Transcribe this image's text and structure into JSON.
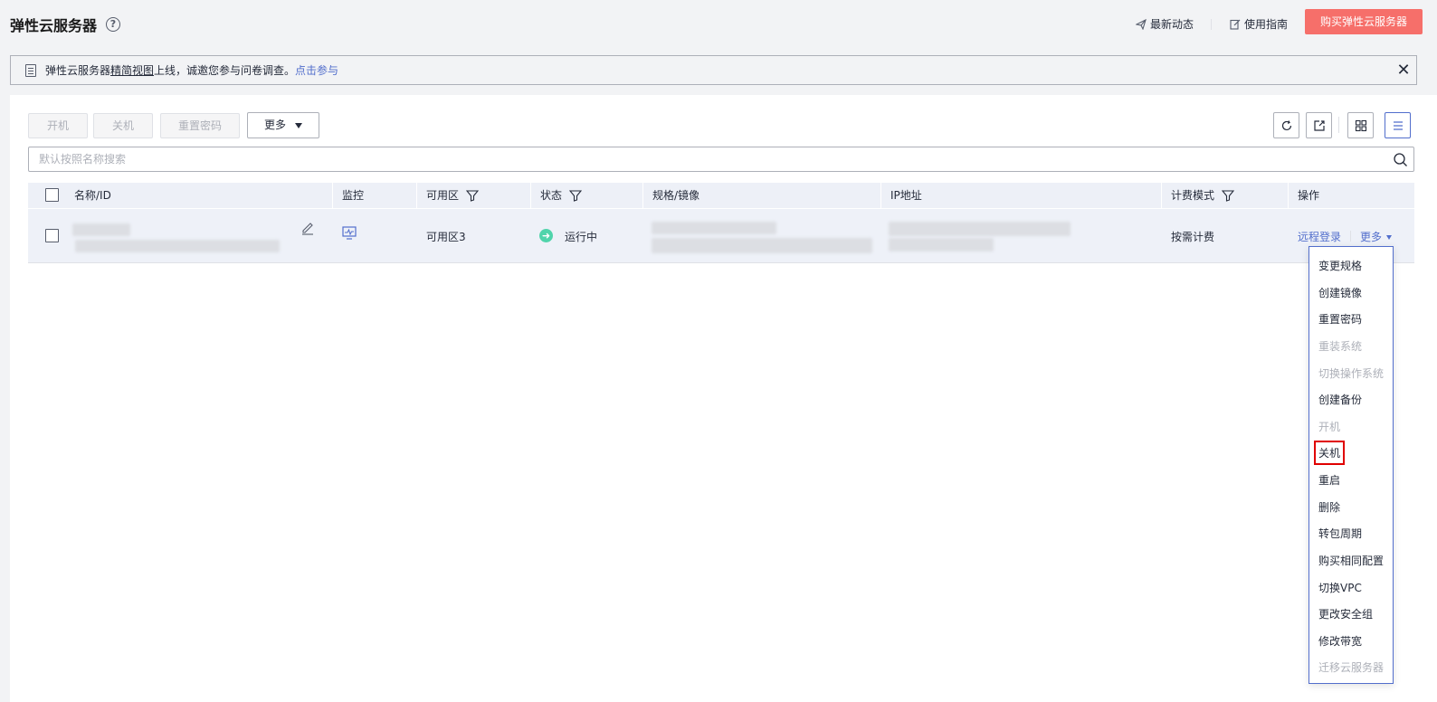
{
  "header": {
    "title": "弹性云服务器",
    "help_icon": "question-circle-icon",
    "links": [
      {
        "label": "最新动态",
        "icon": "send-icon"
      },
      {
        "label": "使用指南",
        "icon": "edit-doc-icon"
      }
    ],
    "buy_button": "购买弹性云服务器",
    "buy_button_color": "#f66f6a"
  },
  "banner": {
    "text_prefix": "弹性云服务器",
    "text_underline": "精简视图",
    "text_suffix": "上线，诚邀您参与问卷调查。",
    "link": "点击参与"
  },
  "toolbar": {
    "start": "开机",
    "stop": "关机",
    "reset_password": "重置密码",
    "more": "更多"
  },
  "search": {
    "placeholder": "默认按照名称搜索",
    "value": ""
  },
  "table": {
    "columns": [
      "名称/ID",
      "监控",
      "可用区",
      "状态",
      "规格/镜像",
      "IP地址",
      "计费模式",
      "操作"
    ],
    "rows": [
      {
        "zone": "可用区3",
        "status": "运行中",
        "billing": "按需计费",
        "actions": {
          "remote_login": "远程登录",
          "more": "更多"
        }
      }
    ]
  },
  "more_menu": {
    "items": [
      {
        "label": "变更规格",
        "disabled": false
      },
      {
        "label": "创建镜像",
        "disabled": false
      },
      {
        "label": "重置密码",
        "disabled": false
      },
      {
        "label": "重装系统",
        "disabled": true
      },
      {
        "label": "切换操作系统",
        "disabled": true
      },
      {
        "label": "创建备份",
        "disabled": false
      },
      {
        "label": "开机",
        "disabled": true
      },
      {
        "label": "关机",
        "disabled": false,
        "highlighted": true
      },
      {
        "label": "重启",
        "disabled": false
      },
      {
        "label": "删除",
        "disabled": false
      },
      {
        "label": "转包周期",
        "disabled": false
      },
      {
        "label": "购买相同配置",
        "disabled": false
      },
      {
        "label": "切换VPC",
        "disabled": false
      },
      {
        "label": "更改安全组",
        "disabled": false
      },
      {
        "label": "修改带宽",
        "disabled": false
      },
      {
        "label": "迁移云服务器",
        "disabled": true
      }
    ]
  },
  "colors": {
    "accent": "#526ecc",
    "status_running": "#50d4ab",
    "highlight_box": "#e00000"
  }
}
